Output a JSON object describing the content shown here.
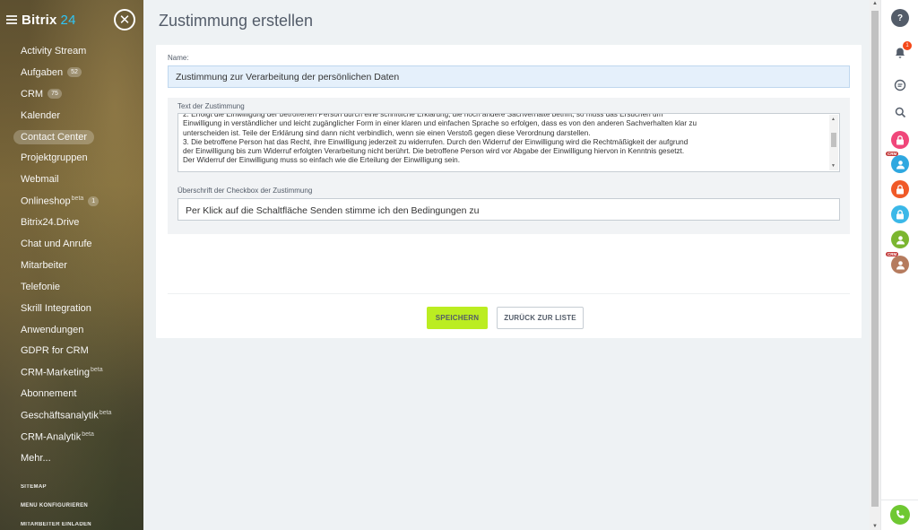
{
  "app": {
    "logo_name": "Bitrix",
    "logo_num": "24"
  },
  "sidebar": {
    "items": [
      {
        "label": "Activity Stream"
      },
      {
        "label": "Aufgaben",
        "counter": "52"
      },
      {
        "label": "CRM",
        "counter": "75"
      },
      {
        "label": "Kalender"
      },
      {
        "label": "Contact Center",
        "active": true
      },
      {
        "label": "Projektgruppen"
      },
      {
        "label": "Webmail"
      },
      {
        "label": "Onlineshop",
        "sup": "beta",
        "counter": "1"
      },
      {
        "label": "Bitrix24.Drive"
      },
      {
        "label": "Chat und Anrufe"
      },
      {
        "label": "Mitarbeiter"
      },
      {
        "label": "Telefonie"
      },
      {
        "label": "Skrill Integration"
      },
      {
        "label": "Anwendungen"
      },
      {
        "label": "GDPR for CRM"
      },
      {
        "label": "CRM-Marketing",
        "sup": "beta"
      },
      {
        "label": "Abonnement"
      },
      {
        "label": "Geschäftsanalytik",
        "sup": "beta"
      },
      {
        "label": "CRM-Analytik",
        "sup": "beta"
      },
      {
        "label": "Mehr..."
      }
    ],
    "footer": {
      "sitemap": "SITEMAP",
      "configure": "MENÜ KONFIGURIEREN",
      "invite": "MITARBEITER EINLADEN"
    }
  },
  "page": {
    "title": "Zustimmung erstellen",
    "name_label": "Name:",
    "name_value": "Zustimmung zur Verarbeitung der persönlichen Daten",
    "text_label": "Text der Zustimmung",
    "text_lines": [
      "2. Erfolgt die Einwilligung der betroffenen Person durch eine schriftliche Erklärung, die noch andere Sachverhalte betrifft, so muss das Ersuchen um",
      "Einwilligung in verständlicher und leicht zugänglicher Form in einer klaren und einfachen Sprache so erfolgen, dass es von den anderen Sachverhalten klar zu",
      "unterscheiden ist. Teile der Erklärung sind dann nicht verbindlich, wenn sie einen Verstoß gegen diese Verordnung darstellen.",
      "3. Die betroffene Person hat das Recht, ihre Einwilligung jederzeit zu widerrufen. Durch den Widerruf der Einwilligung wird die Rechtmäßigkeit der aufgrund",
      "der Einwilligung bis zum Widerruf erfolgten Verarbeitung nicht berührt. Die betroffene Person wird vor Abgabe der Einwilligung hiervon in Kenntnis gesetzt.",
      "Der Widerruf der Einwilligung muss so einfach wie die Erteilung der Einwilligung sein."
    ],
    "checkbox_label": "Überschrift der Checkbox der Zustimmung",
    "checkbox_value": "Per Klick auf die Schaltfläche Senden stimme ich den Bedingungen zu",
    "save_button": "SPEICHERN",
    "back_button": "ZURÜCK ZUR LISTE"
  },
  "rightbar": {
    "notification_count": "1",
    "crm_tag": "CRM",
    "colors": {
      "pink": "#f0467a",
      "blue": "#2fa8e0",
      "orange": "#f05a28",
      "lightblue": "#3bb8e8",
      "green": "#7bb630",
      "brown": "#b57b5e",
      "phone": "#6fc832"
    }
  }
}
